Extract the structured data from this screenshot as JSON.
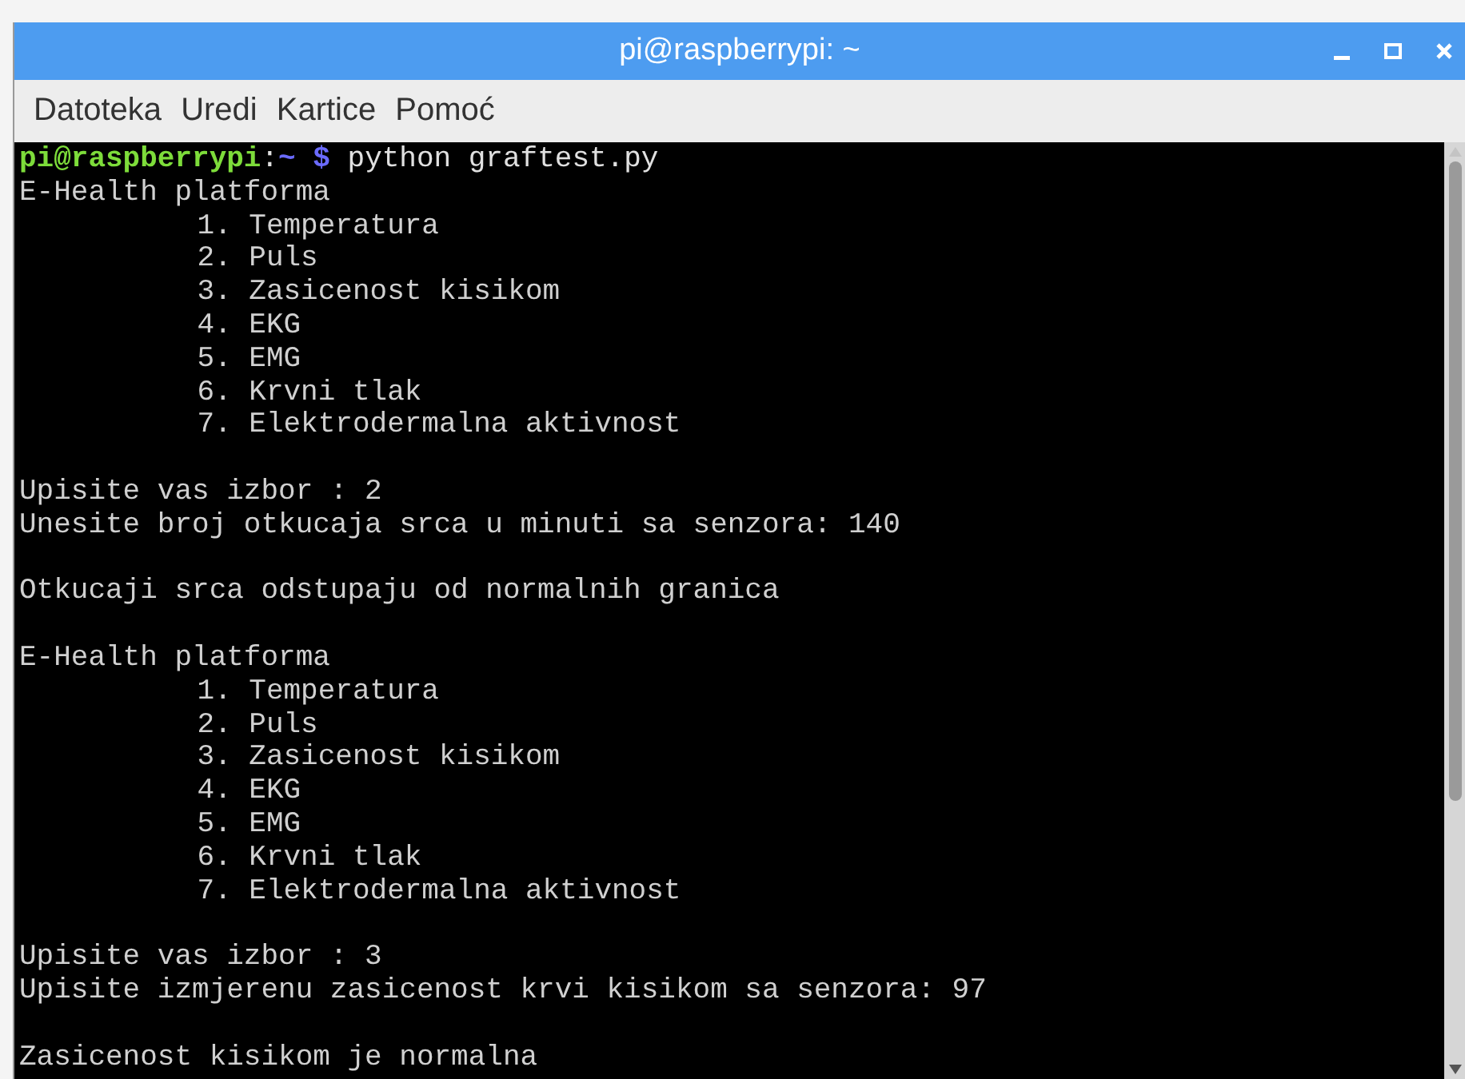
{
  "window": {
    "title": "pi@raspberrypi: ~"
  },
  "menu": [
    "Datoteka",
    "Uredi",
    "Kartice",
    "Pomoć"
  ],
  "terminal": {
    "lines": [
      {
        "kind": "prompt",
        "user_host": "pi@raspberrypi",
        "separator": ":",
        "path": "~",
        "symbol": "$",
        "command": "python graftest.py"
      },
      {
        "kind": "output",
        "text": "E-Health platforma"
      },
      {
        "kind": "indented",
        "text": "1. Temperatura"
      },
      {
        "kind": "indented",
        "text": "2. Puls"
      },
      {
        "kind": "indented",
        "text": "3. Zasicenost kisikom"
      },
      {
        "kind": "indented",
        "text": "4. EKG"
      },
      {
        "kind": "indented",
        "text": "5. EMG"
      },
      {
        "kind": "indented",
        "text": "6. Krvni tlak"
      },
      {
        "kind": "indented",
        "text": "7. Elektrodermalna aktivnost"
      },
      {
        "kind": "blank"
      },
      {
        "kind": "output",
        "text": "Upisite vas izbor : 2"
      },
      {
        "kind": "output",
        "text": "Unesite broj otkucaja srca u minuti sa senzora: 140"
      },
      {
        "kind": "blank"
      },
      {
        "kind": "output",
        "text": "Otkucaji srca odstupaju od normalnih granica"
      },
      {
        "kind": "blank"
      },
      {
        "kind": "output",
        "text": "E-Health platforma"
      },
      {
        "kind": "indented",
        "text": "1. Temperatura"
      },
      {
        "kind": "indented",
        "text": "2. Puls"
      },
      {
        "kind": "indented",
        "text": "3. Zasicenost kisikom"
      },
      {
        "kind": "indented",
        "text": "4. EKG"
      },
      {
        "kind": "indented",
        "text": "5. EMG"
      },
      {
        "kind": "indented",
        "text": "6. Krvni tlak"
      },
      {
        "kind": "indented",
        "text": "7. Elektrodermalna aktivnost"
      },
      {
        "kind": "blank"
      },
      {
        "kind": "output",
        "text": "Upisite vas izbor : 3"
      },
      {
        "kind": "output",
        "text": "Upisite izmjerenu zasicenost krvi kisikom sa senzora: 97"
      },
      {
        "kind": "blank"
      },
      {
        "kind": "output",
        "text": "Zasicenost kisikom je normalna"
      }
    ]
  }
}
